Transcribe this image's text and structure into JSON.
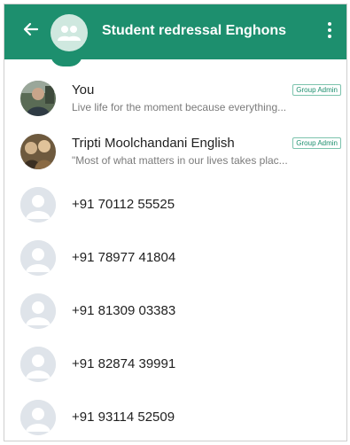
{
  "header": {
    "title": "Student redressal Enghons",
    "back_icon": "arrow-left-icon",
    "group_icon": "group-avatar-icon",
    "menu_icon": "more-vertical-icon",
    "color": "#1d8f6e"
  },
  "participants": [
    {
      "name": "You",
      "status": "Live life for the moment because everything...",
      "badge": "Group Admin",
      "avatar": "photo"
    },
    {
      "name": "Tripti Moolchandani English",
      "status": "\"Most of what matters in our lives takes plac...",
      "badge": "Group Admin",
      "avatar": "photo"
    },
    {
      "name": "+91 70112 55525",
      "avatar": "default"
    },
    {
      "name": "+91 78977 41804",
      "avatar": "default"
    },
    {
      "name": "+91 81309 03383",
      "avatar": "default"
    },
    {
      "name": "+91 82874 39991",
      "avatar": "default"
    },
    {
      "name": "+91 93114 52509",
      "avatar": "default"
    }
  ]
}
